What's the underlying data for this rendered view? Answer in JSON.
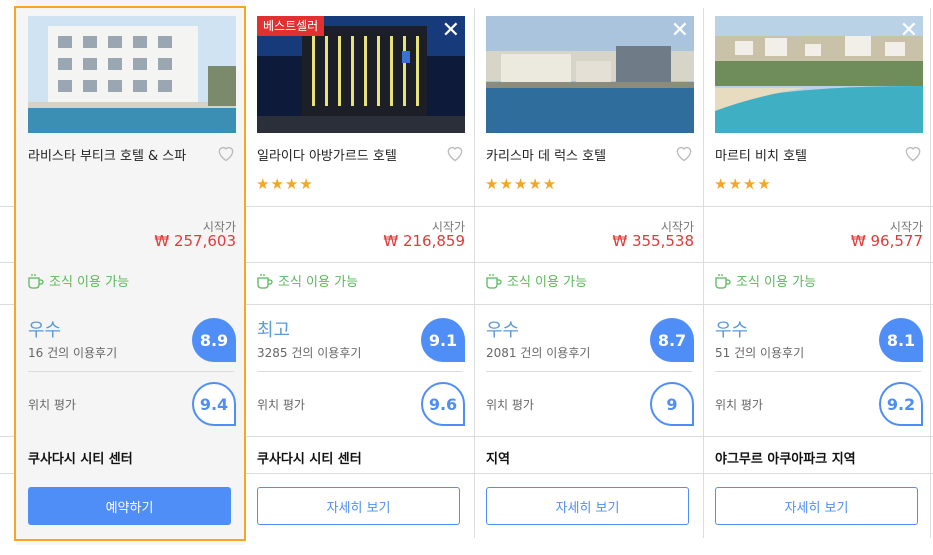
{
  "common": {
    "from_label": "시작가",
    "breakfast_label": "조식 이용 가능",
    "location_rating_label": "위치 평가"
  },
  "hotels": [
    {
      "name": "라비스타 부티크 호텔 & 스파",
      "stars": "",
      "price": "₩ 257,603",
      "rating_label": "우수",
      "reviews": "16 건의 이용후기",
      "score": "8.9",
      "location_score": "9.4",
      "area": "쿠사다시 시티 센터",
      "button": "예약하기",
      "selected": true
    },
    {
      "name": "일라이다 아방가르드 호텔",
      "badge": "베스트셀러",
      "stars": "★★★★",
      "price": "₩ 216,859",
      "rating_label": "최고",
      "reviews": "3285 건의 이용후기",
      "score": "9.1",
      "location_score": "9.6",
      "area": "쿠사다시 시티 센터",
      "button": "자세히 보기"
    },
    {
      "name": "카리스마 데 럭스 호텔",
      "stars": "★★★★★",
      "price": "₩ 355,538",
      "rating_label": "우수",
      "reviews": "2081 건의 이용후기",
      "score": "8.7",
      "location_score": "9",
      "area": "지역",
      "button": "자세히 보기"
    },
    {
      "name": "마르티 비치 호텔",
      "stars": "★★★★",
      "price": "₩ 96,577",
      "rating_label": "우수",
      "reviews": "51 건의 이용후기",
      "score": "8.1",
      "location_score": "9.2",
      "area": "야그무르 아쿠아파크 지역",
      "button": "자세히 보기"
    }
  ],
  "icons": {
    "close": "close-icon",
    "heart": "heart-icon",
    "breakfast": "coffee-cup-icon"
  },
  "colors": {
    "accent": "#4f8ef7",
    "price": "#e03a3a",
    "breakfast": "#5cb85c",
    "star": "#f5a623",
    "selected_border": "#f5a623",
    "badge": "#e03130"
  }
}
